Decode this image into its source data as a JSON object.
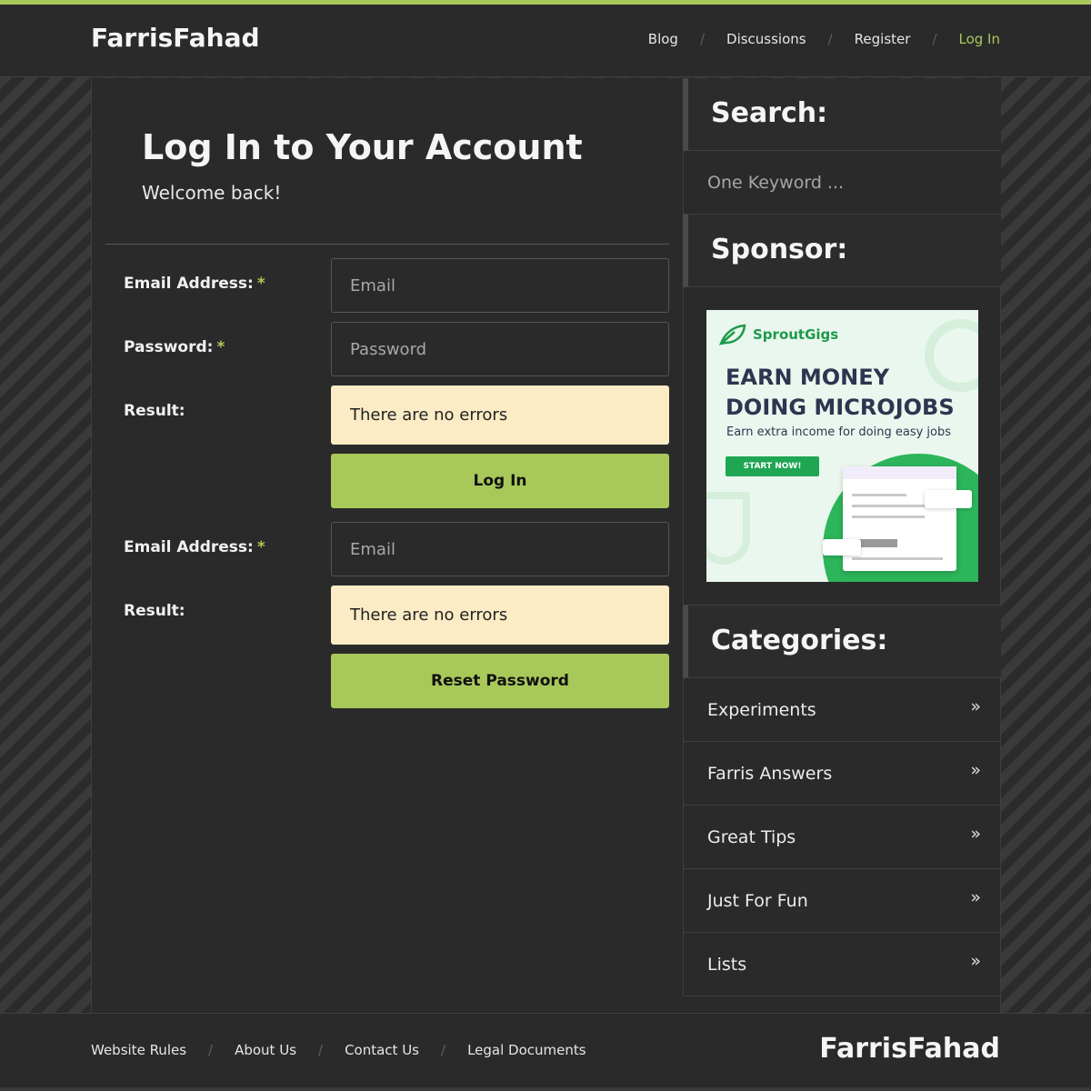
{
  "brand": "FarrisFahad",
  "nav": [
    {
      "label": "Blog",
      "active": false
    },
    {
      "label": "Discussions",
      "active": false
    },
    {
      "label": "Register",
      "active": false
    },
    {
      "label": "Log In",
      "active": true
    }
  ],
  "nav_separator": "/",
  "login": {
    "title": "Log In to Your Account",
    "subtitle": "Welcome back!",
    "email_label": "Email Address:",
    "password_label": "Password:",
    "required_mark": "*",
    "email_placeholder": "Email",
    "password_placeholder": "Password",
    "result_label": "Result:",
    "result_text": "There are no errors",
    "submit_label": "Log In"
  },
  "reset": {
    "email_label": "Email Address:",
    "required_mark": "*",
    "email_placeholder": "Email",
    "result_label": "Result:",
    "result_text": "There are no errors",
    "submit_label": "Reset Password"
  },
  "sidebar": {
    "search_title": "Search:",
    "search_placeholder": "One Keyword ...",
    "sponsor_title": "Sponsor:",
    "ad": {
      "logo_text": "SproutGigs",
      "headline": "EARN MONEY DOING MICROJOBS",
      "sub": "Earn extra income for doing easy jobs",
      "cta": "START NOW!"
    },
    "categories_title": "Categories:",
    "categories": [
      {
        "label": "Experiments",
        "chevron": "»"
      },
      {
        "label": "Farris Answers",
        "chevron": "»"
      },
      {
        "label": "Great Tips",
        "chevron": "»"
      },
      {
        "label": "Just For Fun",
        "chevron": "»"
      },
      {
        "label": "Lists",
        "chevron": "»"
      }
    ]
  },
  "footer": {
    "links": [
      "Website Rules",
      "About Us",
      "Contact Us",
      "Legal Documents"
    ],
    "brand": "FarrisFahad"
  },
  "colors": {
    "accent": "#a8c95a",
    "background": "#2a2a2a",
    "result_bg": "#fbecc5"
  }
}
